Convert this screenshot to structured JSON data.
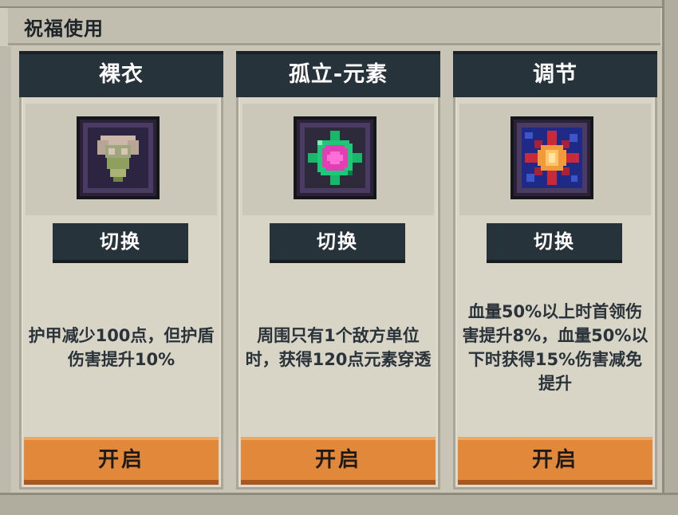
{
  "header": {
    "title": "祝福使用"
  },
  "colors": {
    "card_title_bg": "#27333b",
    "open_button_bg": "#e2883b",
    "panel_bg": "#d8d4c6"
  },
  "cards": [
    {
      "title": "裸衣",
      "icon": "armor-shirt-icon",
      "switch_label": "切换",
      "description": "护甲减少100点，但护盾伤害提升10%",
      "open_label": "开启"
    },
    {
      "title": "孤立-元素",
      "icon": "elemental-gem-icon",
      "switch_label": "切换",
      "description": "周围只有1个敌方单位时，获得120点元素穿透",
      "open_label": "开启"
    },
    {
      "title": "调节",
      "icon": "burst-star-icon",
      "switch_label": "切换",
      "description": "血量50%以上时首领伤害提升8%，血量50%以下时获得15%伤害减免提升",
      "open_label": "开启"
    }
  ]
}
